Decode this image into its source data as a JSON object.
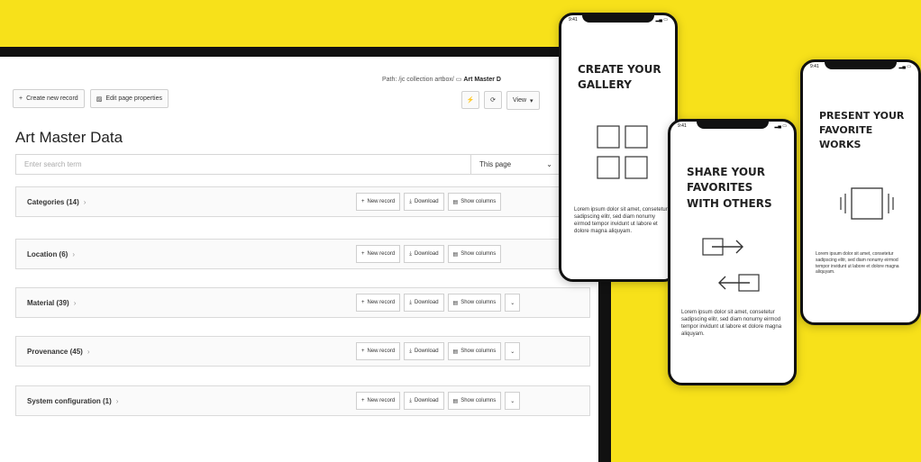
{
  "cms": {
    "path_label": "Path:",
    "path_value": "/jc collection artbox/",
    "path_current": "Art Master D",
    "create_new_label": "Create new record",
    "edit_page_label": "Edit page properties",
    "view_label": "View",
    "title": "Art Master Data",
    "search_placeholder": "Enter search term",
    "page_select": "This page",
    "panels": [
      {
        "title": "Categories (14)"
      },
      {
        "title": "Location (6)"
      },
      {
        "title": "Material (39)"
      },
      {
        "title": "Provenance (45)"
      },
      {
        "title": "System configuration (1)"
      }
    ],
    "new_record_label": "New record",
    "download_label": "Download",
    "show_columns_label": "Show columns"
  },
  "phones": {
    "gallery": {
      "heading": "CREATE YOUR\nGALLERY",
      "lorem": "Lorem ipsum dolor sit amet, consetetur sadipscing elitr, sed diam nonumy eirmod tempor invidunt ut labore et dolore magna aliquyam."
    },
    "share": {
      "heading": "SHARE YOUR\nFAVORITES\nWITH OTHERS",
      "lorem": "Lorem ipsum dolor sit amet, consetetur sadipscing elitr, sed diam nonumy eirmod tempor invidunt ut labore et dolore magna aliquyam."
    },
    "present": {
      "heading": "PRESENT YOUR\nFAVORITE\nWORKS",
      "lorem": "Lorem ipsum dolor sit amet, consetetur sadipscing elitr, sed diam nonumy eirmod tempor invidunt ut labore et dolore magna aliquyam."
    }
  },
  "colors": {
    "accent": "#f7e11a",
    "frame": "#111111"
  }
}
